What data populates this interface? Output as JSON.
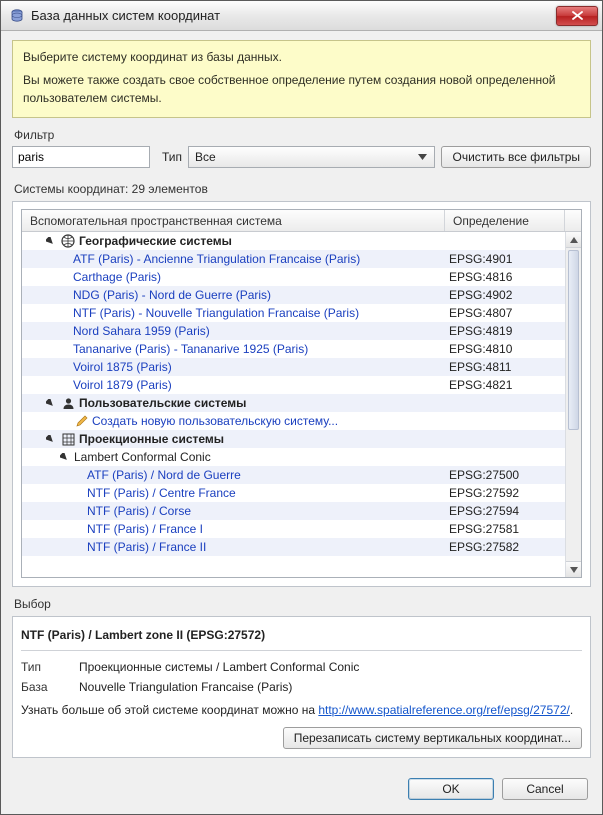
{
  "titlebar": {
    "title": "База данных систем координат"
  },
  "hint": {
    "line1": "Выберите систему координат из базы данных.",
    "line2": "Вы можете также создать свое собственное определение путем создания новой определенной пользователем системы."
  },
  "filter": {
    "label": "Фильтр",
    "value": "paris",
    "type_label": "Тип",
    "type_value": "Все",
    "clear": "Очистить все фильтры"
  },
  "count_label": "Системы координат: 29 элементов",
  "columns": {
    "name": "Вспомогательная пространственная система",
    "def": "Определение"
  },
  "cats": {
    "geo": "Географические системы",
    "user": "Пользовательские системы",
    "create_user": "Создать новую пользовательскую систему...",
    "proj": "Проекционные системы",
    "lcc": "Lambert Conformal Conic"
  },
  "geo_items": [
    {
      "name": "ATF (Paris) - Ancienne Triangulation Francaise (Paris)",
      "def": "EPSG:4901"
    },
    {
      "name": "Carthage (Paris)",
      "def": "EPSG:4816"
    },
    {
      "name": "NDG (Paris) - Nord de Guerre (Paris)",
      "def": "EPSG:4902"
    },
    {
      "name": "NTF (Paris) - Nouvelle Triangulation Francaise (Paris)",
      "def": "EPSG:4807"
    },
    {
      "name": "Nord Sahara 1959 (Paris)",
      "def": "EPSG:4819"
    },
    {
      "name": "Tananarive (Paris) - Tananarive 1925 (Paris)",
      "def": "EPSG:4810"
    },
    {
      "name": "Voirol 1875 (Paris)",
      "def": "EPSG:4811"
    },
    {
      "name": "Voirol 1879 (Paris)",
      "def": "EPSG:4821"
    }
  ],
  "proj_items": [
    {
      "name": "ATF (Paris) / Nord de Guerre",
      "def": "EPSG:27500"
    },
    {
      "name": "NTF (Paris) / Centre France",
      "def": "EPSG:27592"
    },
    {
      "name": "NTF (Paris) / Corse",
      "def": "EPSG:27594"
    },
    {
      "name": "NTF (Paris) / France I",
      "def": "EPSG:27581"
    },
    {
      "name": "NTF (Paris) / France II",
      "def": "EPSG:27582"
    }
  ],
  "selection": {
    "label": "Выбор",
    "title": "NTF (Paris) / Lambert zone II (EPSG:27572)",
    "type_label": "Тип",
    "type_value": "Проекционные системы / Lambert Conformal Conic",
    "base_label": "База",
    "base_value": "Nouvelle Triangulation Francaise (Paris)",
    "more_prefix": "Узнать больше об этой системе координат можно на ",
    "more_url": "http://www.spatialreference.org/ref/epsg/27572/",
    "more_suffix": ".",
    "overwrite": "Перезаписать систему вертикальных координат..."
  },
  "footer": {
    "ok": "OK",
    "cancel": "Cancel"
  }
}
